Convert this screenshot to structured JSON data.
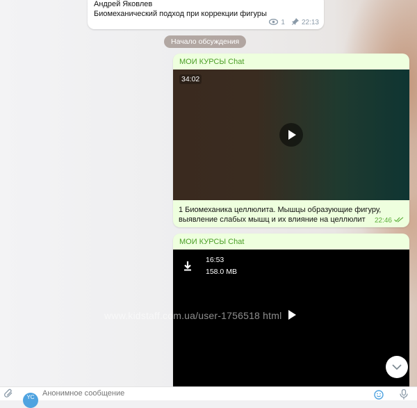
{
  "pinned_message": {
    "author": "Андрей Яковлев",
    "text": "Биомеханический подход при коррекции фигуры",
    "views": "1",
    "time": "22:13"
  },
  "service_message": "Начало обсуждения",
  "messages": [
    {
      "sender": "МОИ КУРСЫ Chat",
      "video_duration": "34:02",
      "caption_line1": "1 Биомеханика целлюлита. Мышцы образующие фигуру,",
      "caption_line2": "выявление слабых мышц и их влияние на целлюлит",
      "time": "22:46"
    },
    {
      "sender": "МОИ КУРСЫ Chat",
      "video_duration": "16:53",
      "file_size": "158.0 MB"
    }
  ],
  "watermark": "www.kidstaff.com.ua/user-1756518 html",
  "composer": {
    "avatar_initials": "YC",
    "placeholder": "Анонимное сообщение"
  },
  "colors": {
    "sender_green": "#4a9e25",
    "bubble_green": "#eeffde",
    "time_green": "#5caf3a",
    "accent_blue": "#4fa3e0"
  }
}
